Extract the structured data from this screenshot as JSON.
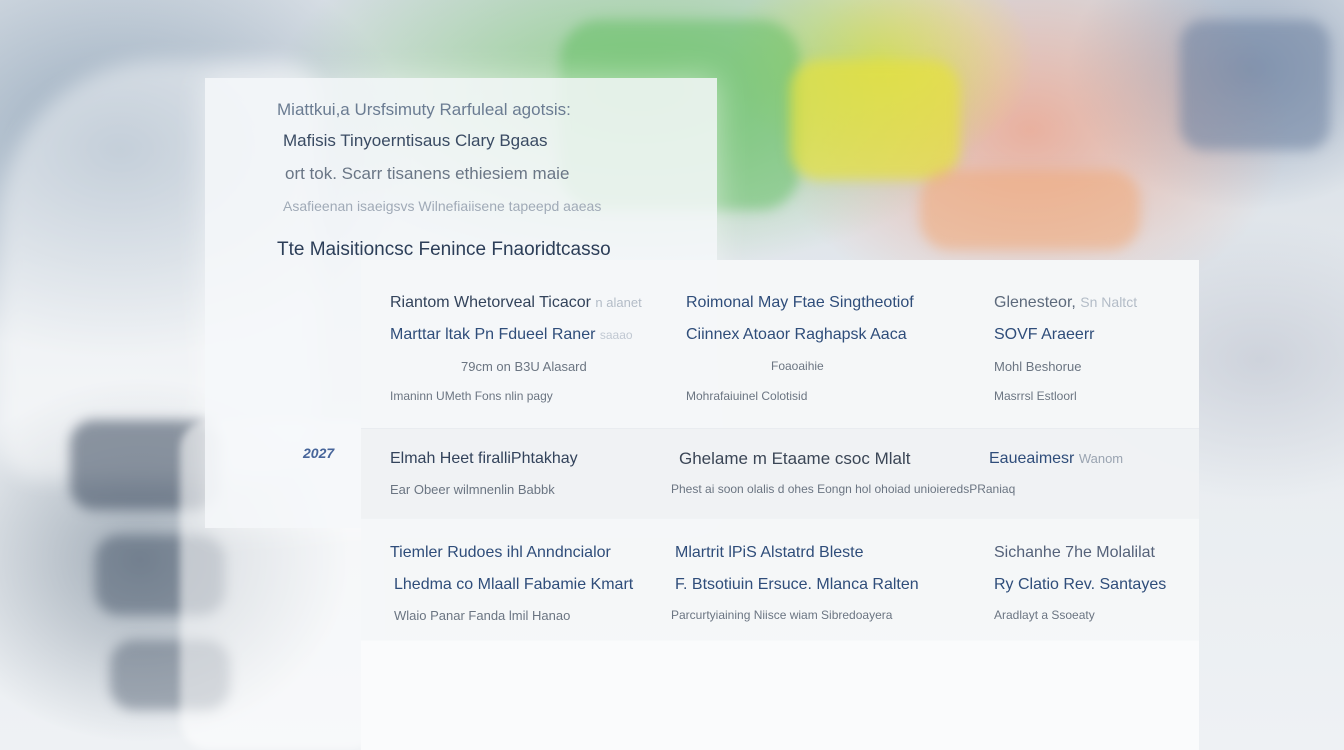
{
  "back_panel": {
    "line1": "Miattkui,a Ursfsimuty Rarfuleal agotsis:",
    "line2": "Mafisis  Tinyoerntisaus Clary Bgaas",
    "line3": "ort tok. Scarr tisanens ethiesiem maie",
    "line4": "Asafieenan isaeigsvs Wilnefiaiisene tapeepd aaeas",
    "line5": "Tte Maisitioncsc Fenince Fnaoridtcasso",
    "year": "2027"
  },
  "front_panel": {
    "row1": {
      "col1": {
        "title": "Riantom Whetorveal Ticacor",
        "title_faint": "n alanet",
        "subtitle": "Marttar ltak Pn Fdueel Raner",
        "subtitle_faint": "saaao",
        "meta": "79cm on B3U Alasard",
        "detail": "Imaninn UMeth Fons nlin pagy"
      },
      "col2": {
        "title": "Roimonal  May Ftae Singtheotiof",
        "subtitle": "Ciinnex Atoaor Raghapsk Aaca",
        "meta": "Foaoaihie",
        "detail": "Mohrafaiuinel Colotisid"
      },
      "col3": {
        "title": "Glenesteor,",
        "title_faint": "Sn Naltct",
        "subtitle": "SOVF Araeerr",
        "meta": "Mohl Beshorue",
        "detail": "Masrrsl Estloorl"
      }
    },
    "row2": {
      "col1": {
        "title": "Elmah Heet firalliPhtakhay",
        "detail": "Ear Obeer wilmnenlin Babbk"
      },
      "col2": {
        "title": "Ghelame m Etaame csoc Mlalt",
        "detail": "Phest ai soon olalis d ohes Eongn hol ohoiad unioieredsPRaniaq"
      },
      "col3": {
        "title": "Eaueaimesr",
        "title_faint": "Wanom"
      }
    },
    "row3": {
      "col1": {
        "title": "Tiemler Rudoes ihl Anndncialor",
        "subtitle": "Lhedma co Mlaall Fabamie Kmart",
        "detail": "Wlaio Panar Fanda lmil Hanao"
      },
      "col2": {
        "title": "Mlartrit lPiS Alstatrd Bleste",
        "subtitle": "F. Btsotiuin Ersuce. Mlanca Ralten",
        "detail": "Parcurtyiaining Niisce wiam Sibredoayera"
      },
      "col3": {
        "title": "Sichanhe  7he Molalilat",
        "subtitle": "Ry Clatio Rev. Santayes",
        "detail": "Aradlayt a Ssoeaty"
      }
    }
  },
  "colors": {
    "accent": "#2f4d7a",
    "text": "#3b4656",
    "muted": "#6b7582"
  }
}
